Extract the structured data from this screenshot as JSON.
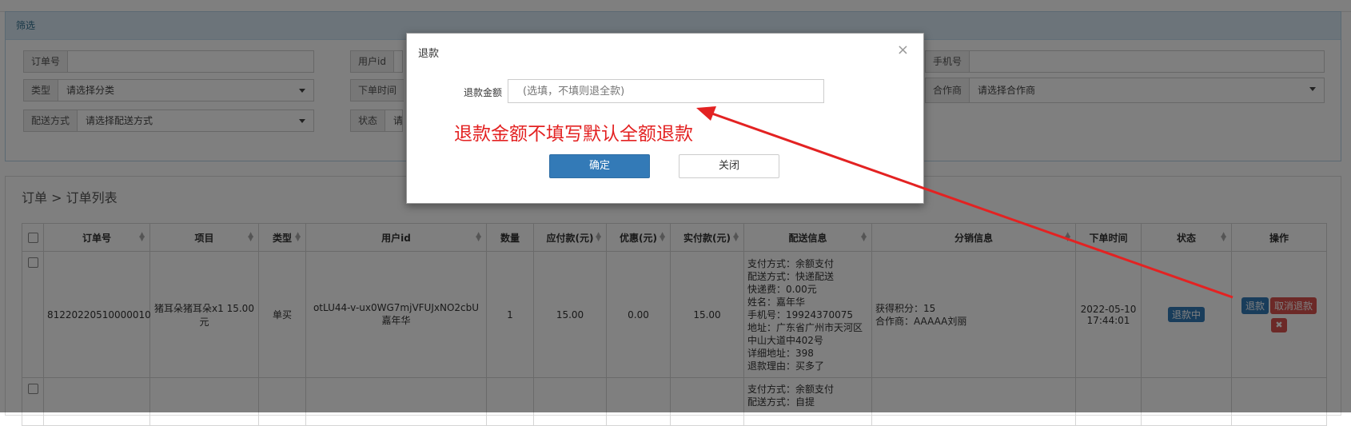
{
  "filter": {
    "title": "筛选",
    "order_no_label": "订单号",
    "user_id_label": "用户id",
    "phone_label": "手机号",
    "type_label": "类型",
    "type_value": "请选择分类",
    "order_time_label": "下单时间",
    "partner_label": "合作商",
    "partner_value": "请选择合作商",
    "delivery_label": "配送方式",
    "delivery_value": "请选择配送方式",
    "status_label": "状态",
    "status_value": "请"
  },
  "list": {
    "breadcrumb": "订单 > 订单列表",
    "columns": [
      "订单号",
      "项目",
      "类型",
      "用户id",
      "数量",
      "应付款(元)",
      "优惠(元)",
      "实付款(元)",
      "配送信息",
      "分销信息",
      "下单时间",
      "状态",
      "操作"
    ],
    "rows": [
      {
        "order_no": "81220220510000010",
        "item": "猪耳朵猪耳朵x1 15.00元",
        "type": "单买",
        "user_id": "otLU44-v-ux0WG7mjVFUJxNO2cbU",
        "user_name": "嘉年华",
        "qty": "1",
        "payable": "15.00",
        "discount": "0.00",
        "paid": "15.00",
        "delivery": [
          "支付方式：余额支付",
          "配送方式：快递配送",
          "快递费：0.00元",
          "姓名：嘉年华",
          "手机号：19924370075",
          "地址：广东省广州市天河区",
          "中山大道中402号",
          "详细地址：398",
          "退款理由：买多了"
        ],
        "dist": [
          "获得积分：15",
          "合作商：AAAAA刘丽"
        ],
        "time_date": "2022-05-10",
        "time_clock": "17:44:01",
        "status": "退款中",
        "refund_btn": "退款",
        "cancel_btn": "取消退款",
        "delete_icon": "✖"
      },
      {
        "delivery": [
          "支付方式：余额支付",
          "配送方式：自提"
        ]
      }
    ]
  },
  "modal": {
    "title": "退款",
    "close_icon": "×",
    "amount_label": "退款金额",
    "amount_placeholder": "(选填，不填则退全款)",
    "annotation": "退款金额不填写默认全额退款",
    "confirm_label": "确定",
    "close_label": "关闭"
  },
  "colors": {
    "primary": "#337ab7",
    "danger": "#d9534f",
    "annotation": "#e32222"
  }
}
